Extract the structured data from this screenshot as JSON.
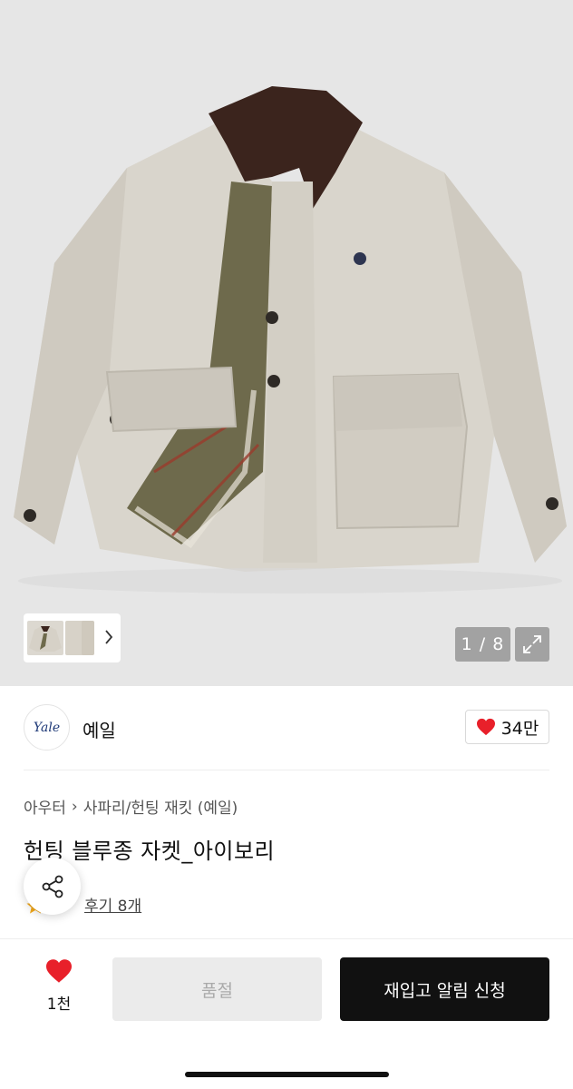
{
  "gallery": {
    "counter": "1 / 8",
    "thumbnail_count": 3,
    "background": "#e6e6e6"
  },
  "brand": {
    "logo_text": "Yale",
    "name": "예일",
    "likes": "34만"
  },
  "product": {
    "breadcrumb": [
      "아우터",
      "사파리/헌팅 재킷 (예일)"
    ],
    "title": "헌팅 블루종 자켓_아이보리",
    "reviews": "후기 8개"
  },
  "bottom_bar": {
    "wish_count": "1천",
    "soldout_label": "품절",
    "restock_label": "재입고 알림 신청"
  },
  "icons": {
    "heart": "heart-icon",
    "share": "share-icon",
    "expand": "expand-icon",
    "chevron": "chevron-right-icon",
    "star": "star-icon"
  },
  "colors": {
    "accent_red": "#e8202a",
    "primary_button": "#111111",
    "disabled_button": "#ebebeb"
  }
}
